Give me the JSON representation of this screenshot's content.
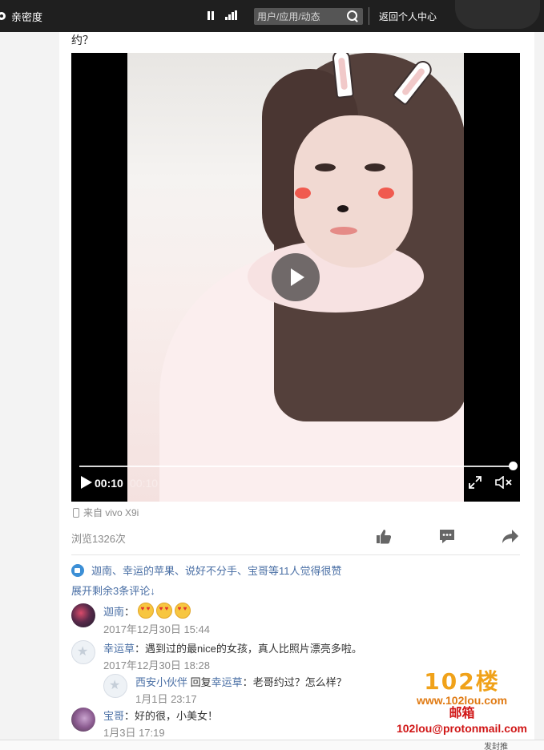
{
  "topbar": {
    "intimacy_label": "亲密度",
    "search_placeholder": "用户/应用/动态",
    "return_label": "返回个人中心"
  },
  "post": {
    "text_tail": "约？",
    "video": {
      "current_time": "00:10",
      "total_time": "00:10",
      "progress": 1.0
    },
    "device": "来自 vivo X9i",
    "views": "浏览1326次"
  },
  "likes": {
    "text": "迦南、幸运的苹果、说好不分手、宝哥等11人觉得很赞",
    "expand": "展开剩余3条评论↓"
  },
  "comments": [
    {
      "name": "迦南",
      "sep": "：",
      "text": "",
      "emoji_count": 3,
      "time": "2017年12月30日 15:44"
    },
    {
      "name": "幸运草",
      "sep": "：",
      "text": "遇到过的最nice的女孩，真人比照片漂亮多啦。",
      "time": "2017年12月30日 18:28"
    },
    {
      "name": "西安小伙伴",
      "reply_word": "回复",
      "reply_to": "幸运草",
      "sep": "：",
      "text": "老哥约过？怎么样？",
      "time": "1月1日 23:17"
    },
    {
      "name": "宝哥",
      "sep": "：",
      "text": "好的很，小美女！",
      "time": "1月3日 17:19"
    }
  ],
  "watermark": {
    "big": "102楼",
    "url": "www.102lou.com",
    "mail_title": "邮箱",
    "mail": "102lou@protonmail.com"
  },
  "footer": {
    "chip": "发封推"
  },
  "colors": {
    "link": "#4a6fa5",
    "topbar": "#1f1f1f",
    "like_badge": "#3c8fd6"
  }
}
